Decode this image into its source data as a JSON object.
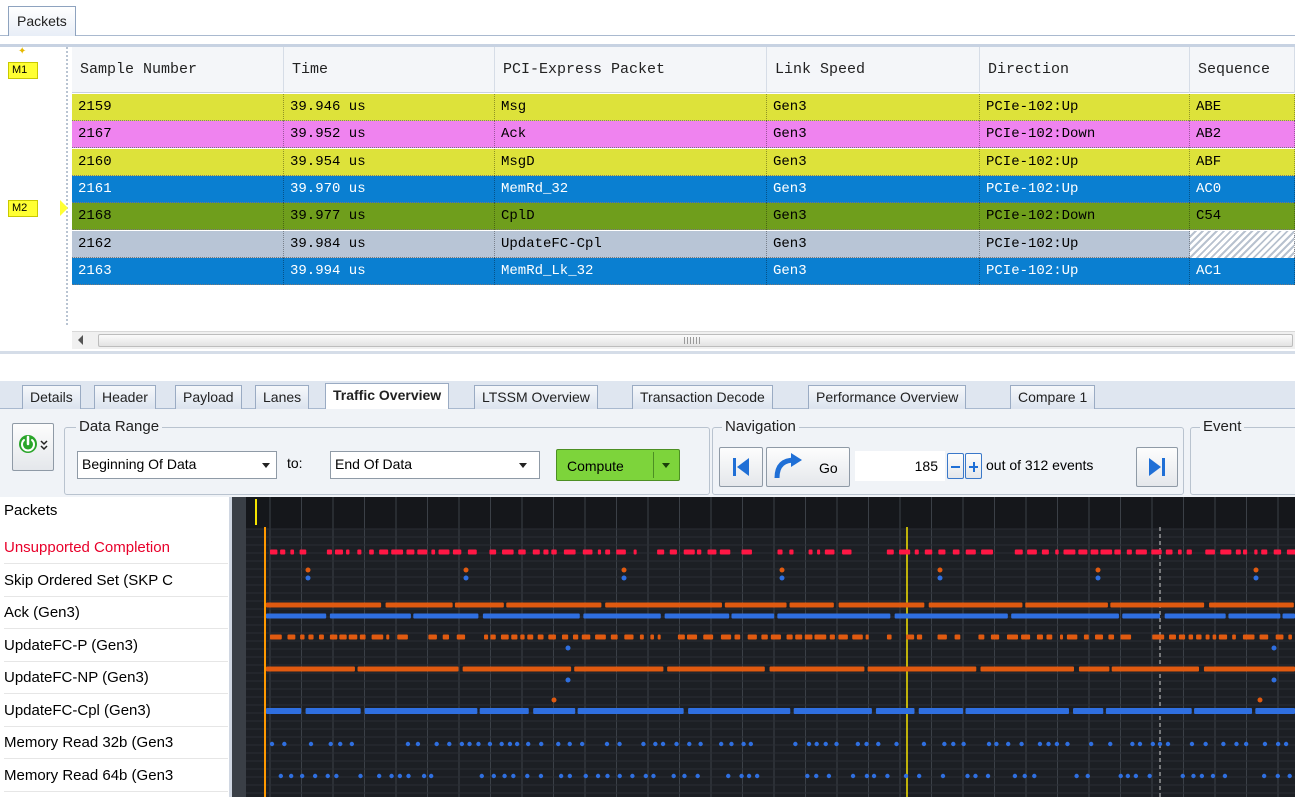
{
  "top_tabs": {
    "packets": "Packets"
  },
  "markers": {
    "m1": "M1",
    "m2": "M2"
  },
  "grid": {
    "columns": [
      "Sample Number",
      "Time",
      "PCI-Express Packet",
      "Link Speed",
      "Direction",
      "Sequence"
    ],
    "rows": [
      {
        "sample": "2159",
        "time": "39.946 us",
        "packet": "Msg",
        "speed": "Gen3",
        "direction": "PCIe-102:Up",
        "sequence": "ABE",
        "bg": "#dde23a",
        "fg": "#000000"
      },
      {
        "sample": "2167",
        "time": "39.952 us",
        "packet": "Ack",
        "speed": "Gen3",
        "direction": "PCIe-102:Down",
        "sequence": "AB2",
        "bg": "#ef83ef",
        "fg": "#000000"
      },
      {
        "sample": "2160",
        "time": "39.954 us",
        "packet": "MsgD",
        "speed": "Gen3",
        "direction": "PCIe-102:Up",
        "sequence": "ABF",
        "bg": "#dde23a",
        "fg": "#000000"
      },
      {
        "sample": "2161",
        "time": "39.970 us",
        "packet": "MemRd_32",
        "speed": "Gen3",
        "direction": "PCIe-102:Up",
        "sequence": "AC0",
        "bg": "#0a7fd1",
        "fg": "#ffffff"
      },
      {
        "sample": "2168",
        "time": "39.977 us",
        "packet": "CplD",
        "speed": "Gen3",
        "direction": "PCIe-102:Down",
        "sequence": "C54",
        "bg": "#6f9e1c",
        "fg": "#000000"
      },
      {
        "sample": "2162",
        "time": "39.984 us",
        "packet": "UpdateFC-Cpl",
        "speed": "Gen3",
        "direction": "PCIe-102:Up",
        "sequence": "",
        "bg": "#b8c5d6",
        "fg": "#000000",
        "hatch_sequence": true
      },
      {
        "sample": "2163",
        "time": "39.994 us",
        "packet": "MemRd_Lk_32",
        "speed": "Gen3",
        "direction": "PCIe-102:Up",
        "sequence": "AC1",
        "bg": "#0a7fd1",
        "fg": "#ffffff"
      }
    ]
  },
  "bottom_tabs": [
    "Details",
    "Header",
    "Payload",
    "Lanes",
    "Traffic Overview",
    "LTSSM Overview",
    "Transaction Decode",
    "Performance Overview",
    "Compare 1"
  ],
  "active_bottom_tab": "Traffic Overview",
  "toolbar": {
    "power_icon": "power-icon",
    "data_range": {
      "legend": "Data Range",
      "from_value": "Beginning Of Data",
      "to_label": "to:",
      "to_value": "End Of Data",
      "compute_label": "Compute"
    },
    "navigation": {
      "legend": "Navigation",
      "go_label": "Go",
      "event_value": "185",
      "out_of_text": "out of 312 events"
    },
    "event": {
      "legend": "Event"
    }
  },
  "timeline": {
    "header": "Packets",
    "rows": [
      {
        "label": "Unsupported Completion",
        "color": "#e8002a"
      },
      {
        "label": "Skip Ordered Set (SKP C",
        "color": "#000000"
      },
      {
        "label": "Ack (Gen3)",
        "color": "#000000"
      },
      {
        "label": "UpdateFC-P (Gen3)",
        "color": "#000000"
      },
      {
        "label": "UpdateFC-NP (Gen3)",
        "color": "#000000"
      },
      {
        "label": "UpdateFC-Cpl (Gen3)",
        "color": "#000000"
      },
      {
        "label": "Memory Read 32b (Gen3",
        "color": "#000000"
      },
      {
        "label": "Memory Read 64b (Gen3",
        "color": "#000000"
      }
    ],
    "colors": {
      "red": "#ff1744",
      "orange": "#e05a10",
      "blue": "#2f6fe0",
      "cursor_yellow": "#f5e400",
      "cursor_orange": "#ff9900"
    }
  }
}
